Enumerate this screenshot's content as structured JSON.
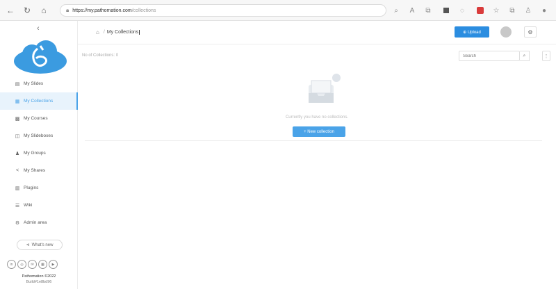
{
  "browser": {
    "url_host": "https://my.pathomation.com",
    "url_path": "/collections",
    "icons": [
      "back-icon",
      "refresh-icon",
      "home-icon",
      "lock-icon",
      "search-icon",
      "star-icon",
      "extensions-icon",
      "collections-icon",
      "menu-icon"
    ]
  },
  "sidebar": {
    "collapse": "‹",
    "items": [
      {
        "label": "My Slides",
        "icon": "▤"
      },
      {
        "label": "My Collections",
        "icon": "▦",
        "active": true
      },
      {
        "label": "My Courses",
        "icon": "▩"
      },
      {
        "label": "My Slideboxes",
        "icon": "◫"
      },
      {
        "label": "My Groups",
        "icon": "♟"
      },
      {
        "label": "My Shares",
        "icon": "<"
      },
      {
        "label": "Plugins",
        "icon": "▥"
      },
      {
        "label": "Wiki",
        "icon": "☰"
      },
      {
        "label": "Admin area",
        "icon": "⚙"
      }
    ],
    "whats_new": "What's new",
    "footer_line1": "Pathomation ©2022",
    "footer_line2": "Build#1e8bd96"
  },
  "topbar": {
    "breadcrumb_home": "⌂",
    "breadcrumb_sep": "/",
    "breadcrumb_current": "My Collections",
    "upload_label": "⊕ Upload",
    "settings_icon": "⚙"
  },
  "main": {
    "count_text": "No of Collections: 0",
    "search_placeholder": "Search",
    "empty_text": "Currently you have no collections.",
    "new_collection_label": "+ New collection"
  },
  "colors": {
    "accent": "#4aa3e8",
    "upload": "#2b8de0",
    "logo": "#3b9be0"
  }
}
